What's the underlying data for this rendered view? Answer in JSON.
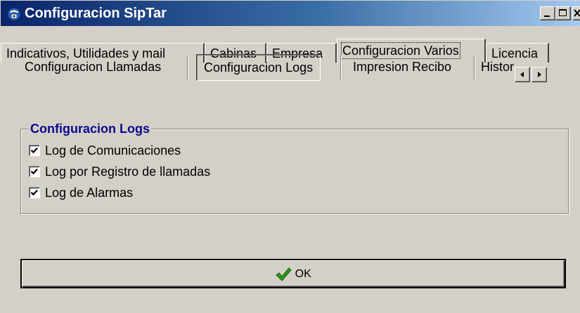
{
  "window": {
    "title": "Configuracion SipTar",
    "controls": [
      "minimize-icon",
      "maximize-icon",
      "close-icon"
    ]
  },
  "tabs": [
    {
      "label": "Indicativos, Utilidades y mail",
      "active": false
    },
    {
      "label": "Cabinas",
      "active": false
    },
    {
      "label": "Empresa",
      "active": false
    },
    {
      "label": "Configuracion Varios",
      "active": true
    },
    {
      "label": "Licencia",
      "active": false
    }
  ],
  "subtabs": [
    {
      "label": "Configuracion Llamadas",
      "active": false
    },
    {
      "label": "Configuracion Logs",
      "active": true
    },
    {
      "label": "Impresion Recibo",
      "active": false
    },
    {
      "label": "Histori",
      "active": false
    }
  ],
  "group": {
    "title": "Configuracion Logs",
    "options": [
      {
        "label": "Log de Comunicaciones",
        "checked": true
      },
      {
        "label": "Log por Registro de llamadas",
        "checked": true
      },
      {
        "label": "Log de Alarmas",
        "checked": true
      }
    ]
  },
  "ok_button": {
    "label": "OK",
    "icon": "checkmark-icon",
    "icon_color": "#2e9c1c"
  },
  "colors": {
    "titlebar_start": "#0a246a",
    "titlebar_end": "#a6caf0",
    "face": "#d4d0c8",
    "group_title": "#0a0a8c"
  }
}
